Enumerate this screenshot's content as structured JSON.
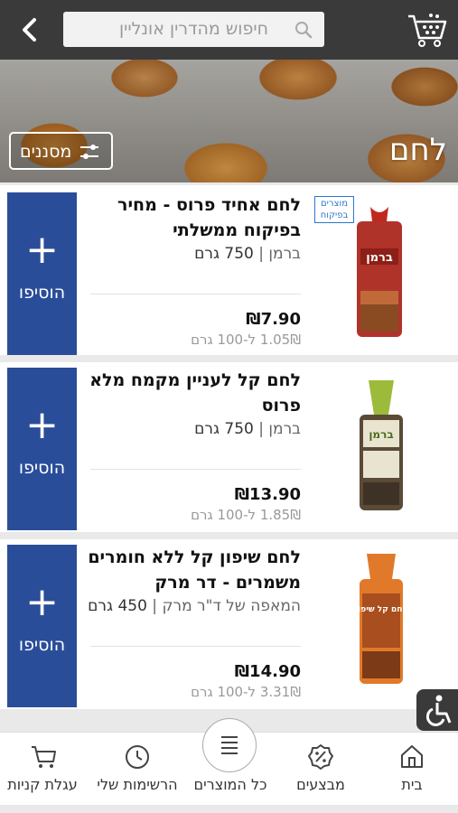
{
  "search": {
    "placeholder": "חיפוש מהדרין אונליין"
  },
  "header": {
    "category_title": "לחם",
    "filter_label": "מסננים"
  },
  "badge": {
    "line1": "מוצרים",
    "line2": "בפיקוח"
  },
  "add_label": "הוסיפו",
  "products": [
    {
      "name": "לחם אחיד פרוס - מחיר בפיקוח ממשלתי",
      "brand": "ברמן",
      "weight": "750 גרם",
      "price": "₪7.90",
      "unit_price": "1.05₪ ל-100 גרם",
      "image_label": "ברמן",
      "has_badge": true
    },
    {
      "name": "לחם קל לעניין מקמח מלא פרוס",
      "brand": "ברמן",
      "weight": "750 גרם",
      "price": "₪13.90",
      "unit_price": "1.85₪ ל-100 גרם",
      "image_label": "ברמן",
      "has_badge": false
    },
    {
      "name": "לחם שיפון קל ללא חומרים משמרים - דר מרק",
      "brand": "המאפה של ד\"ר מרק",
      "weight": "450 גרם",
      "price": "₪14.90",
      "unit_price": "3.31₪ ל-100 גרם",
      "image_label": "לחם קל שיפון",
      "has_badge": false
    }
  ],
  "nav": {
    "home": "בית",
    "deals": "מבצעים",
    "all_products": "כל המוצרים",
    "my_lists": "הרשימות שלי",
    "cart": "עגלת קניות"
  },
  "colors": {
    "topbar": "#3a3a3a",
    "add_button": "#2a4d9a",
    "badge": "#2c78c9"
  }
}
